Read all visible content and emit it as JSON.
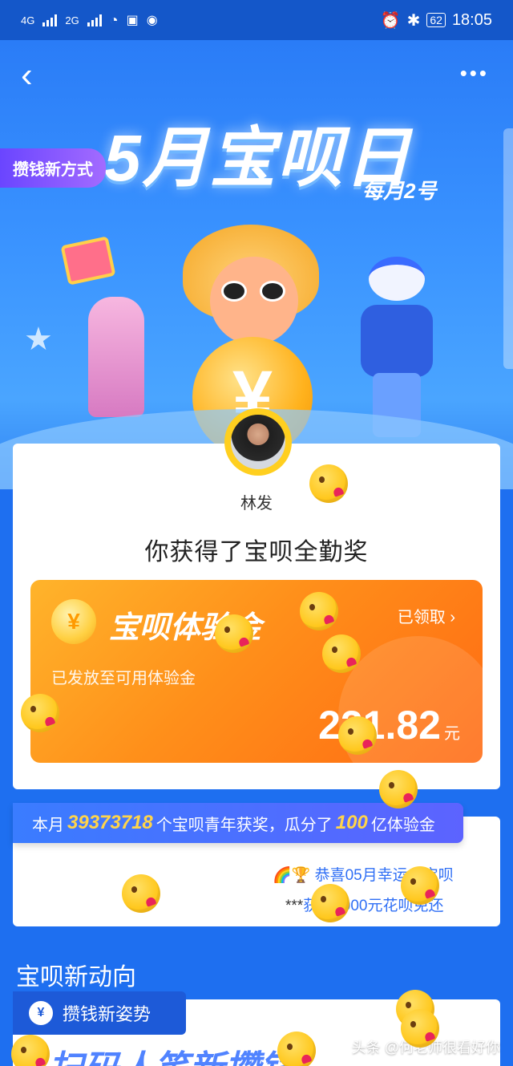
{
  "status_bar": {
    "network": "4G",
    "network2": "2G",
    "battery": "62",
    "time": "18:05"
  },
  "header": {
    "title": "5月宝呗日",
    "subtitle": "每月2号",
    "badge": "攒钱新方式"
  },
  "award": {
    "nickname": "林发",
    "title": "你获得了宝呗全勤奖",
    "card_title": "宝呗体验金",
    "claim_label": "已领取",
    "desc": "已发放至可用体验金",
    "amount": "221.82",
    "unit": "元",
    "coin_symbol": "¥"
  },
  "stats": {
    "prefix": "本月",
    "count": "39373718",
    "middle": "个宝呗青年获奖，瓜分了",
    "pool": "100",
    "suffix": "亿体验金",
    "ticker1": "🌈🏆 恭喜05月幸运大宝呗",
    "ticker2_mask": "***",
    "ticker2": "获得2000元花呗免还"
  },
  "section": {
    "title": "宝呗新动向",
    "tab": "攒钱新姿势",
    "tab_icon": "¥",
    "teaser": "扫码人笔新攒钱"
  },
  "watermark": "头条 @何老师很看好你",
  "colors": {
    "primary": "#1e6ff0",
    "orange": "#ff8f1a",
    "gold": "#ffd44a"
  }
}
